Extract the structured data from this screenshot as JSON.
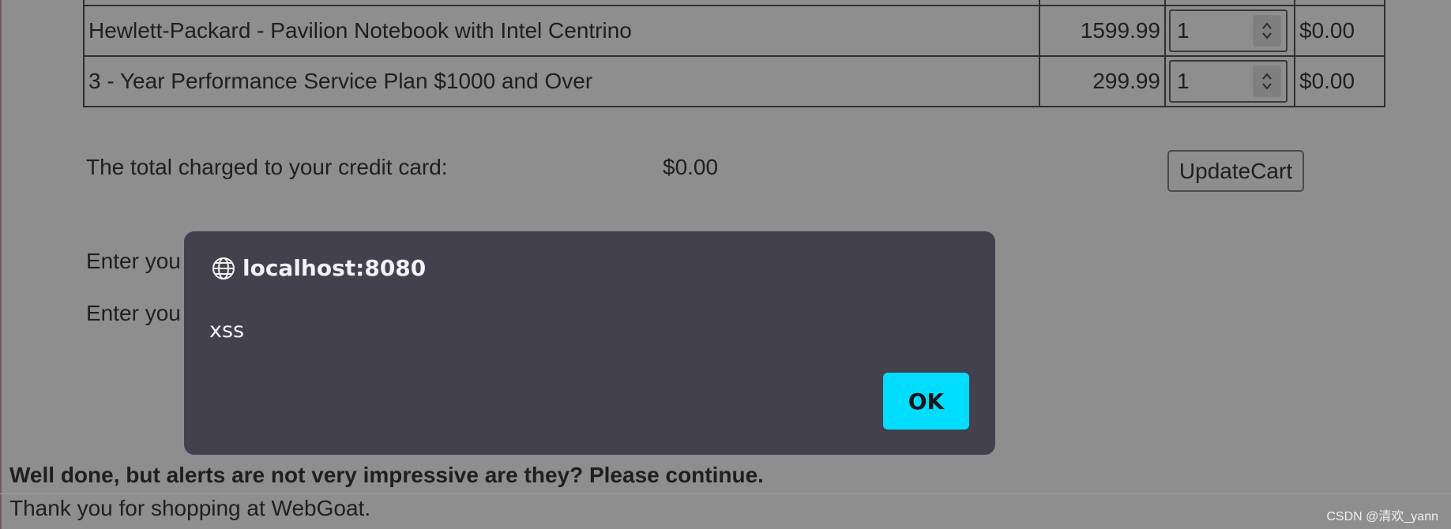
{
  "cart": {
    "rows": [
      {
        "description": "Hewlett-Packard - Pavilion Notebook with Intel Centrino",
        "price": "1599.99",
        "quantity": "1",
        "total": "$0.00"
      },
      {
        "description": "3 - Year Performance Service Plan $1000 and Over",
        "price": "299.99",
        "quantity": "1",
        "total": "$0.00"
      }
    ]
  },
  "summary": {
    "total_label": "The total charged to your credit card:",
    "total_value": "$0.00",
    "update_button": "UpdateCart"
  },
  "form": {
    "line1": "Enter you",
    "line2": "Enter you"
  },
  "dialog": {
    "origin": "localhost:8080",
    "message": "xss",
    "ok_label": "OK",
    "icon": "globe-icon"
  },
  "feedback": {
    "message": "Well done, but alerts are not very impressive are they? Please continue.",
    "thanks": "Thank you for shopping at WebGoat."
  },
  "watermark": "CSDN @清欢_yann",
  "colors": {
    "overlay_background": "#8e8e8f",
    "dialog_background": "#42414d",
    "ok_button": "#00ddff"
  }
}
